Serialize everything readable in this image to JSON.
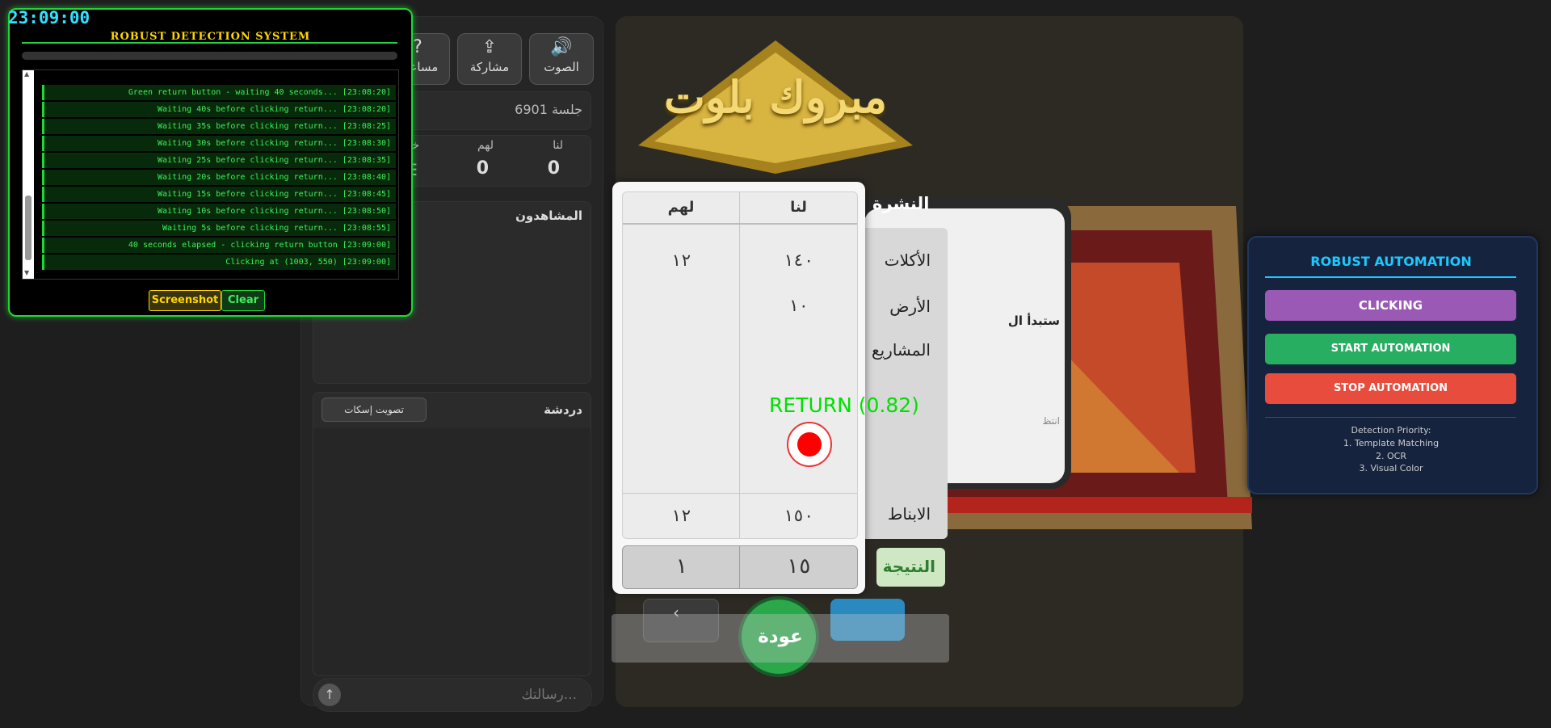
{
  "detection": {
    "time": "23:09:00",
    "title": "ROBUST DETECTION SYSTEM",
    "logs": [
      "Green return button - waiting 40 seconds... [23:08:20]",
      "Waiting 40s before clicking return... [23:08:20]",
      "Waiting 35s before clicking return... [23:08:25]",
      "Waiting 30s before clicking return... [23:08:30]",
      "Waiting 25s before clicking return... [23:08:35]",
      "Waiting 20s before clicking return... [23:08:40]",
      "Waiting 15s before clicking return... [23:08:45]",
      "Waiting 10s before clicking return... [23:08:50]",
      "Waiting 5s before clicking return... [23:08:55]",
      "40 seconds elapsed - clicking return button [23:09:00]",
      "Clicking at (1003, 550) [23:09:00]"
    ],
    "screenshot_label": "Screenshot",
    "clear_label": "Clear"
  },
  "toolbar": {
    "sound_label": "الصوت",
    "share_label": "مشاركة",
    "help_label": "مساعدة"
  },
  "session": {
    "label": "جلسة 6901"
  },
  "team_scores": {
    "us_label": "لنا",
    "them_label": "لهم",
    "opponents_label": "خصوم",
    "us_value": "0",
    "them_value": "0"
  },
  "viewers": {
    "title": "المشاهدون"
  },
  "chat": {
    "title": "دردشة",
    "mute_vote_label": "تصويت إسكات",
    "placeholder": "رسالتك..."
  },
  "game": {
    "logo_text": "مبروك بلوت",
    "round_title": "النشرة",
    "card_partial_text": "ستبدأ ال",
    "card_partial_sub": "انتظ",
    "row_labels": {
      "eats": "الأكلات",
      "ground": "الأرض",
      "projects": "المشاريع",
      "total": "الابناط",
      "result": "النتيجة"
    },
    "score_headers": {
      "us": "لنا",
      "them": "لهم"
    },
    "eats_us": "١٤٠",
    "eats_them": "١٢",
    "ground_us": "١٠",
    "total_us": "١٥٠",
    "total_them": "١٢",
    "result_us": "١٥",
    "result_them": "١",
    "return_label": "عودة",
    "detect_label": "RETURN (0.82)"
  },
  "automation": {
    "title": "ROBUST AUTOMATION",
    "status": "CLICKING",
    "start_label": "START AUTOMATION",
    "stop_label": "STOP AUTOMATION",
    "priority_title": "Detection Priority:",
    "priority_items": [
      "1. Template Matching",
      "2. OCR",
      "3. Visual Color"
    ]
  },
  "colors": {
    "log_green": "#3df25a",
    "accent_blue": "#1ec8ff",
    "status_purple": "#9b59b6",
    "start_green": "#27ae60",
    "stop_red": "#e74c3c",
    "title_gold": "#ffd700"
  }
}
